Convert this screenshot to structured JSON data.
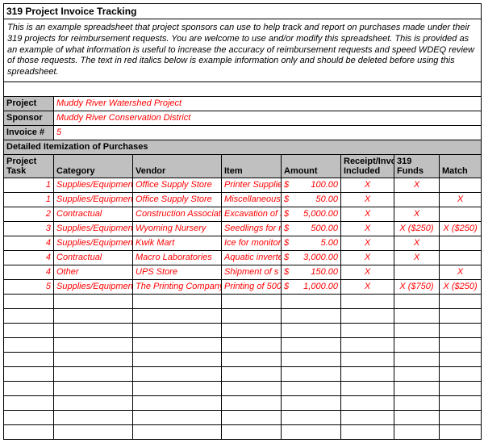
{
  "title": "319 Project Invoice Tracking",
  "description": "This is an example spreadsheet that project sponsors can use to help track and report on purchases made under their 319 projects for reimbursement requests.  You are welcome to use and/or modify this spreadsheet.  This is provided as an example of what information is useful to increase the accuracy of reimbursement requests and speed WDEQ review of those requests.  The text in red italics below is example information only and should be deleted before using this spreadsheet.",
  "meta": {
    "project_label": "Project",
    "project_value": "Muddy River Watershed Project",
    "sponsor_label": "Sponsor",
    "sponsor_value": "Muddy River Conservation District",
    "invoice_label": "Invoice #",
    "invoice_value": "5"
  },
  "section_header": "Detailed Itemization of Purchases",
  "columns": {
    "task": "Project Task",
    "category": "Category",
    "vendor": "Vendor",
    "item": "Item",
    "amount": "Amount",
    "receipt": "Receipt/Invoice Included",
    "funds": "319 Funds",
    "match": "Match"
  },
  "currency": "$",
  "rows": [
    {
      "task": "1",
      "category": "Supplies/Equipment",
      "vendor": "Office Supply Store",
      "item": "Printer Supplies",
      "amount": "100.00",
      "receipt": "X",
      "funds": "X",
      "match": ""
    },
    {
      "task": "1",
      "category": "Supplies/Equipment",
      "vendor": "Office Supply Store",
      "item": "Miscellaneous",
      "amount": "50.00",
      "receipt": "X",
      "funds": "",
      "match": "X"
    },
    {
      "task": "2",
      "category": "Contractual",
      "vendor": "Construction Associates",
      "item": "Excavation of s",
      "amount": "5,000.00",
      "receipt": "X",
      "funds": "X",
      "match": ""
    },
    {
      "task": "3",
      "category": "Supplies/Equipment",
      "vendor": "Wyoming Nursery",
      "item": "Seedlings for r",
      "amount": "500.00",
      "receipt": "X",
      "funds": "X ($250)",
      "match": "X ($250)"
    },
    {
      "task": "4",
      "category": "Supplies/Equipment",
      "vendor": "Kwik Mart",
      "item": "Ice for monitor",
      "amount": "5.00",
      "receipt": "X",
      "funds": "X",
      "match": ""
    },
    {
      "task": "4",
      "category": "Contractual",
      "vendor": "Macro Laboratories",
      "item": "Aquatic inverte",
      "amount": "3,000.00",
      "receipt": "X",
      "funds": "X",
      "match": ""
    },
    {
      "task": "4",
      "category": "Other",
      "vendor": "UPS Store",
      "item": "Shipment of s",
      "amount": "150.00",
      "receipt": "X",
      "funds": "",
      "match": "X"
    },
    {
      "task": "5",
      "category": "Supplies/Equipment",
      "vendor": "The Printing Company",
      "item": "Printing of 500",
      "amount": "1,000.00",
      "receipt": "X",
      "funds": "X ($750)",
      "match": "X ($250)"
    }
  ],
  "empty_rows": 10
}
